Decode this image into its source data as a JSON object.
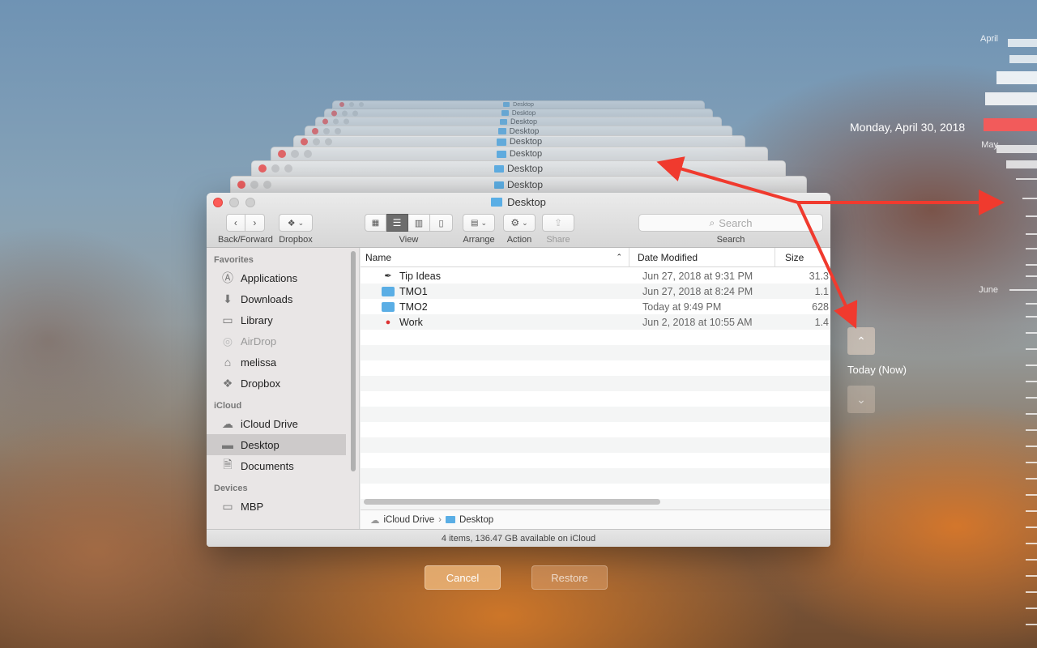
{
  "stack_windows": [
    {
      "title": "Desktop"
    },
    {
      "title": "Desktop"
    },
    {
      "title": "Desktop"
    },
    {
      "title": "Desktop"
    },
    {
      "title": "Desktop"
    },
    {
      "title": "Desktop"
    },
    {
      "title": "Desktop"
    },
    {
      "title": "Desktop"
    }
  ],
  "window": {
    "title": "Desktop",
    "toolbar": {
      "back_forward_label": "Back/Forward",
      "dropbox_label": "Dropbox",
      "view_label": "View",
      "arrange_label": "Arrange",
      "action_label": "Action",
      "share_label": "Share",
      "search_label": "Search",
      "search_placeholder": "Search"
    },
    "sidebar": {
      "favorites_header": "Favorites",
      "favorites": [
        {
          "label": "Applications",
          "icon": "applications-icon"
        },
        {
          "label": "Downloads",
          "icon": "downloads-icon"
        },
        {
          "label": "Library",
          "icon": "folder-icon"
        },
        {
          "label": "AirDrop",
          "icon": "airdrop-icon"
        },
        {
          "label": "melissa",
          "icon": "home-icon"
        },
        {
          "label": "Dropbox",
          "icon": "dropbox-icon"
        }
      ],
      "icloud_header": "iCloud",
      "icloud": [
        {
          "label": "iCloud Drive",
          "icon": "cloud-icon"
        },
        {
          "label": "Desktop",
          "icon": "desktop-icon",
          "selected": true
        },
        {
          "label": "Documents",
          "icon": "document-icon"
        }
      ],
      "devices_header": "Devices",
      "devices": [
        {
          "label": "MBP",
          "icon": "laptop-icon"
        }
      ]
    },
    "columns": {
      "name": "Name",
      "date": "Date Modified",
      "size": "Size"
    },
    "files": [
      {
        "name": "Tip Ideas",
        "date": "Jun 27, 2018 at 9:31 PM",
        "size": "31.3",
        "icon": "document-icon"
      },
      {
        "name": "TMO1",
        "date": "Jun 27, 2018 at 8:24 PM",
        "size": "1.1",
        "icon": "folder-icon"
      },
      {
        "name": "TMO2",
        "date": "Today at 9:49 PM",
        "size": "628",
        "icon": "folder-icon"
      },
      {
        "name": "Work",
        "date": "Jun 2, 2018 at 10:55 AM",
        "size": "1.4",
        "icon": "apple-app-icon"
      }
    ],
    "pathbar": {
      "root": "iCloud Drive",
      "current": "Desktop"
    },
    "status": "4 items, 136.47 GB available on iCloud"
  },
  "buttons": {
    "cancel": "Cancel",
    "restore": "Restore"
  },
  "time_machine": {
    "current_date": "Monday, April 30, 2018",
    "today_label": "Today (Now)",
    "months": [
      "April",
      "May",
      "June"
    ]
  },
  "colors": {
    "accent_red": "#f25b5b",
    "annotation_red": "#f03a2e",
    "folder_blue": "#5aaee5"
  }
}
